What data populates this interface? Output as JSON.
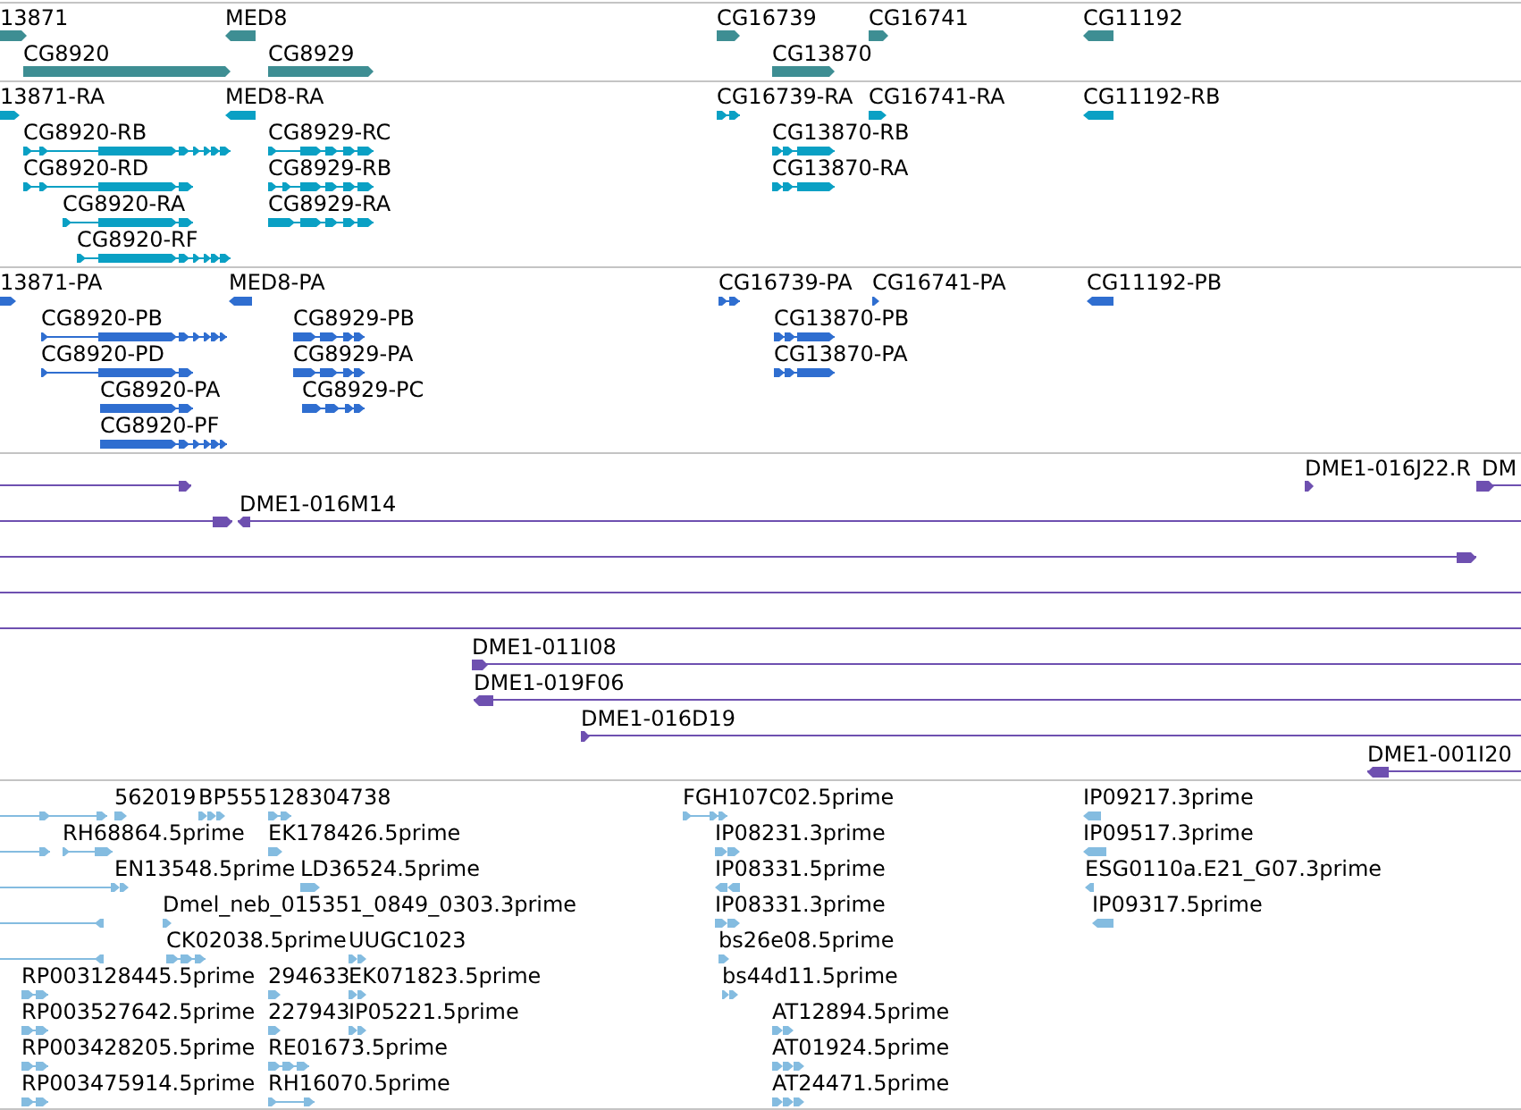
{
  "tracks": [
    {
      "color": "#3e8e93",
      "features": [
        {
          "label": "13871",
          "reverse": false
        },
        {
          "label": "MED8",
          "reverse": true
        },
        {
          "label": "CG16739",
          "reverse": false
        },
        {
          "label": "CG16741",
          "reverse": false
        },
        {
          "label": "CG11192",
          "reverse": true
        },
        {
          "label": "CG8920",
          "reverse": false
        },
        {
          "label": "CG8929",
          "reverse": false
        },
        {
          "label": "CG13870",
          "reverse": false
        }
      ]
    },
    {
      "color": "#0aa0c4",
      "features": [
        {
          "label": "13871-RA",
          "reverse": false
        },
        {
          "label": "MED8-RA",
          "reverse": true
        },
        {
          "label": "CG16739-RA",
          "reverse": false
        },
        {
          "label": "CG16741-RA",
          "reverse": false
        },
        {
          "label": "CG11192-RB",
          "reverse": true
        },
        {
          "label": "CG8920-RB",
          "reverse": false
        },
        {
          "label": "CG8929-RC",
          "reverse": false
        },
        {
          "label": "CG13870-RB",
          "reverse": false
        },
        {
          "label": "CG8920-RD",
          "reverse": false
        },
        {
          "label": "CG8929-RB",
          "reverse": false
        },
        {
          "label": "CG13870-RA",
          "reverse": false
        },
        {
          "label": "CG8920-RA",
          "reverse": false
        },
        {
          "label": "CG8929-RA",
          "reverse": false
        },
        {
          "label": "CG8920-RF",
          "reverse": false
        }
      ]
    },
    {
      "color": "#2f6ed0",
      "features": [
        {
          "label": "13871-PA",
          "reverse": false
        },
        {
          "label": "MED8-PA",
          "reverse": true
        },
        {
          "label": "CG16739-PA",
          "reverse": false
        },
        {
          "label": "CG16741-PA",
          "reverse": false
        },
        {
          "label": "CG11192-PB",
          "reverse": true
        },
        {
          "label": "CG8920-PB",
          "reverse": false
        },
        {
          "label": "CG8929-PB",
          "reverse": false
        },
        {
          "label": "CG13870-PB",
          "reverse": false
        },
        {
          "label": "CG8920-PD",
          "reverse": false
        },
        {
          "label": "CG8929-PA",
          "reverse": false
        },
        {
          "label": "CG13870-PA",
          "reverse": false
        },
        {
          "label": "CG8920-PA",
          "reverse": false
        },
        {
          "label": "CG8929-PC",
          "reverse": false
        },
        {
          "label": "CG8920-PF",
          "reverse": false
        }
      ]
    },
    {
      "color": "#6e50b0",
      "features": [
        {
          "kind": "arrow",
          "reverse": false
        },
        {
          "kind": "arrow",
          "label": "DME1-016J22.R",
          "reverse": false
        },
        {
          "kind": "arrow",
          "label": "DM",
          "reverse": false
        },
        {
          "kind": "arrow",
          "reverse": false
        },
        {
          "kind": "arrow",
          "label": "DME1-016M14",
          "reverse": true
        },
        {
          "kind": "arrow",
          "reverse": false
        },
        {
          "kind": "line"
        },
        {
          "kind": "line"
        },
        {
          "kind": "arrow",
          "label": "DME1-011I08",
          "reverse": false
        },
        {
          "kind": "arrow",
          "label": "DME1-019F06",
          "reverse": true
        },
        {
          "kind": "arrow",
          "label": "DME1-016D19",
          "reverse": false
        },
        {
          "kind": "arrow",
          "label": "DME1-001I20",
          "reverse": true
        }
      ]
    },
    {
      "color": "#84bce0",
      "features": [
        {
          "kind": "arrow",
          "reverse": false
        },
        {
          "kind": "arrow",
          "label": "562019",
          "reverse": false
        },
        {
          "kind": "arrow",
          "label": "BP555",
          "reverse": false
        },
        {
          "kind": "arrow",
          "label": "128304738",
          "reverse": false
        },
        {
          "kind": "arrow",
          "label": "FGH107C02.5prime",
          "reverse": false
        },
        {
          "kind": "arrow",
          "label": "IP09217.3prime",
          "reverse": true
        },
        {
          "kind": "arrow",
          "reverse": false
        },
        {
          "kind": "arrow",
          "label": "RH68864.5prime",
          "reverse": false
        },
        {
          "kind": "arrow",
          "label": "EK178426.5prime",
          "reverse": false
        },
        {
          "kind": "arrow",
          "label": "IP08231.3prime",
          "reverse": false
        },
        {
          "kind": "arrow",
          "label": "IP09517.3prime",
          "reverse": true
        },
        {
          "kind": "line"
        },
        {
          "kind": "arrow",
          "label": "EN13548.5prime",
          "reverse": false
        },
        {
          "kind": "arrow",
          "label": "LD36524.5prime",
          "reverse": false
        },
        {
          "kind": "arrow",
          "label": "IP08331.5prime",
          "reverse": true
        },
        {
          "kind": "arrow",
          "label": "ESG0110a.E21_G07.3prime",
          "reverse": true
        },
        {
          "kind": "arrow",
          "reverse": true
        },
        {
          "kind": "arrow",
          "label": "Dmel_neb_015351_0849_0303.3prime",
          "reverse": false
        },
        {
          "kind": "arrow",
          "label": "IP08331.3prime",
          "reverse": false
        },
        {
          "kind": "arrow",
          "label": "IP09317.5prime",
          "reverse": true
        },
        {
          "kind": "arrow",
          "reverse": true
        },
        {
          "kind": "arrow",
          "label": "CK02038.5prime",
          "reverse": false
        },
        {
          "kind": "arrow",
          "label": "UUGC1023",
          "reverse": false
        },
        {
          "kind": "arrow",
          "label": "bs26e08.5prime",
          "reverse": false
        },
        {
          "kind": "arrow",
          "label": "RP003128445.5prime",
          "reverse": false
        },
        {
          "kind": "arrow",
          "label": "294633",
          "reverse": false
        },
        {
          "kind": "arrow",
          "label": "EK071823.5prime",
          "reverse": false
        },
        {
          "kind": "arrow",
          "label": "bs44d11.5prime",
          "reverse": false
        },
        {
          "kind": "arrow",
          "label": "RP003527642.5prime",
          "reverse": false
        },
        {
          "kind": "arrow",
          "label": "227943",
          "reverse": false
        },
        {
          "kind": "arrow",
          "label": "IP05221.5prime",
          "reverse": false
        },
        {
          "kind": "arrow",
          "label": "AT12894.5prime",
          "reverse": false
        },
        {
          "kind": "arrow",
          "label": "RP003428205.5prime",
          "reverse": false
        },
        {
          "kind": "arrow",
          "label": "RE01673.5prime",
          "reverse": false
        },
        {
          "kind": "arrow",
          "label": "AT01924.5prime",
          "reverse": false
        },
        {
          "kind": "arrow",
          "label": "RP003475914.5prime",
          "reverse": false
        },
        {
          "kind": "arrow",
          "label": "RH16070.5prime",
          "reverse": false
        },
        {
          "kind": "arrow",
          "label": "AT24471.5prime",
          "reverse": false
        }
      ]
    }
  ]
}
